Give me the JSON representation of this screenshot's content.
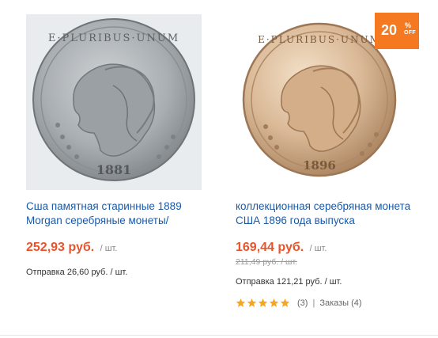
{
  "products": [
    {
      "title": "Сша памятная старинные 1889 Morgan серебряные монеты/",
      "price": "252,93 руб.",
      "unit": "/ шт.",
      "shipping": "Отправка 26,60 руб. / шт.",
      "image_icon": "silver-morgan-dollar-coin",
      "coin_year": "1881",
      "coin_legend": "E·PLURIBUS·UNUM"
    },
    {
      "title": "коллекционная серебряная монета США 1896 года выпуска",
      "price": "169,44 руб.",
      "unit": "/ шт.",
      "old_price": "211,49 руб. / шт.",
      "shipping": "Отправка 121,21 руб. / шт.",
      "rating_count": "(3)",
      "separator": "|",
      "orders": "Заказы (4)",
      "stars": 5,
      "image_icon": "gold-morgan-dollar-coin",
      "coin_year": "1896",
      "coin_legend": "E·PLURIBUS·UNUM"
    }
  ],
  "badge": {
    "number": "20",
    "percent": "%",
    "off": "OFF",
    "color": "#f47920"
  },
  "colors": {
    "title_link": "#1a5aa8",
    "price": "#e7542c",
    "star": "#f5a623"
  }
}
